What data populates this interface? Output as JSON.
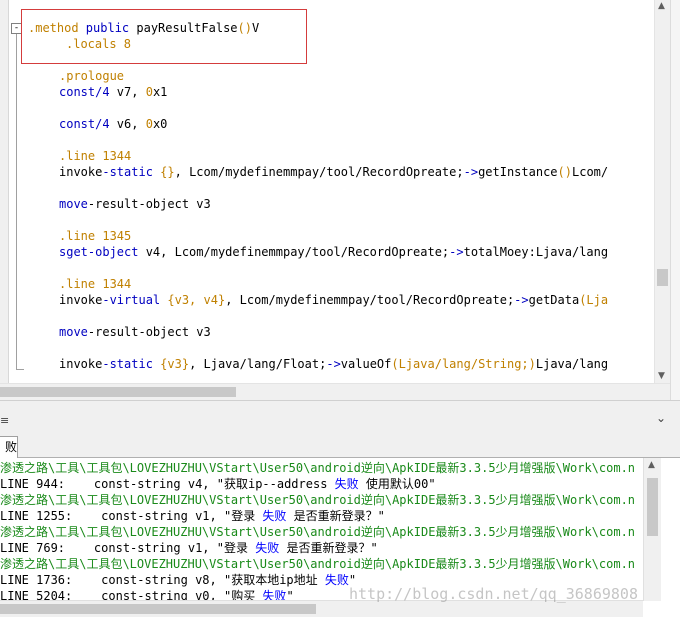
{
  "colors": {
    "directive": "#c08000",
    "keyword": "#0000c0",
    "path_text": "#1a8a1a",
    "highlight_border": "#d43c3c",
    "error_word": "#0000ff"
  },
  "editor": {
    "fold_toggle": "-",
    "lines": {
      "l01": {
        "a": ".method",
        "b": " public",
        "c": " payResultFalse",
        "d": "()",
        "e": "V"
      },
      "l02": {
        "a": ".locals",
        "b": " 8"
      },
      "l03": {
        "a": ".prologue"
      },
      "l04": {
        "a": "const/4",
        "b": " v7, ",
        "c": "0",
        "d": "x1"
      },
      "l05": {
        "a": "const/4",
        "b": " v6, ",
        "c": "0",
        "d": "x0"
      },
      "l06": {
        "a": ".line",
        "b": " 1344"
      },
      "l07": {
        "a": "invoke",
        "b": "-static",
        "c": " {}",
        "d": ", Lcom/mydefinemmpay/tool/RecordOpreate;",
        "e": "->",
        "f": "getInstance",
        "g": "()",
        "h": "Lcom/"
      },
      "l08": {
        "a": "move",
        "b": "-result-object",
        "c": " v3"
      },
      "l09": {
        "a": ".line",
        "b": " 1345"
      },
      "l10": {
        "a": "sget-object",
        "b": " v4, Lcom/mydefinemmpay/tool/RecordOpreate;",
        "c": "->",
        "d": "totalMoey:Ljava/lang"
      },
      "l11": {
        "a": ".line",
        "b": " 1344"
      },
      "l12": {
        "a": "invoke",
        "b": "-virtual",
        "c": " {v3, v4}",
        "d": ", Lcom/mydefinemmpay/tool/RecordOpreate;",
        "e": "->",
        "f": "getData",
        "g": "(Lja"
      },
      "l13": {
        "a": "move",
        "b": "-result-object",
        "c": " v3"
      },
      "l14": {
        "a": "invoke",
        "b": "-static",
        "c": " {v3}",
        "d": ", Ljava/lang/Float;",
        "e": "->",
        "f": "valueOf",
        "g": "(Ljava/lang/String;)",
        "h": "Ljava/lang"
      }
    }
  },
  "panel": {
    "left_mark": "≡",
    "chevron": "⌄",
    "tab_label": "败"
  },
  "output": {
    "p1": "渗透之路\\工具\\工具包\\LOVEZHUZHU\\VStart\\User50\\android逆向\\ApkIDE最新3.3.5少月增强版\\Work\\com.n",
    "r1": {
      "a": "LINE 944:    const-string v4, \"获取ip--address ",
      "b": "失败",
      "c": " 使用默认00\""
    },
    "p2": "渗透之路\\工具\\工具包\\LOVEZHUZHU\\VStart\\User50\\android逆向\\ApkIDE最新3.3.5少月增强版\\Work\\com.n",
    "r2": {
      "a": "LINE 1255:    const-string v1, \"登录 ",
      "b": "失败",
      "c": " 是否重新登录？\""
    },
    "p3": "渗透之路\\工具\\工具包\\LOVEZHUZHU\\VStart\\User50\\android逆向\\ApkIDE最新3.3.5少月增强版\\Work\\com.n",
    "r3": {
      "a": "LINE 769:    const-string v1, \"登录 ",
      "b": "失败",
      "c": " 是否重新登录？\""
    },
    "p4": "渗透之路\\工具\\工具包\\LOVEZHUZHU\\VStart\\User50\\android逆向\\ApkIDE最新3.3.5少月增强版\\Work\\com.n",
    "r4": {
      "a": "LINE 1736:    const-string v8, \"获取本地ip地址 ",
      "b": "失败",
      "c": "\""
    },
    "r5": {
      "a": "LINE 5204:    const-string v0, \"购买 ",
      "b": "失败",
      "c": "\""
    }
  },
  "watermark": "http://blog.csdn.net/qq_36869808"
}
